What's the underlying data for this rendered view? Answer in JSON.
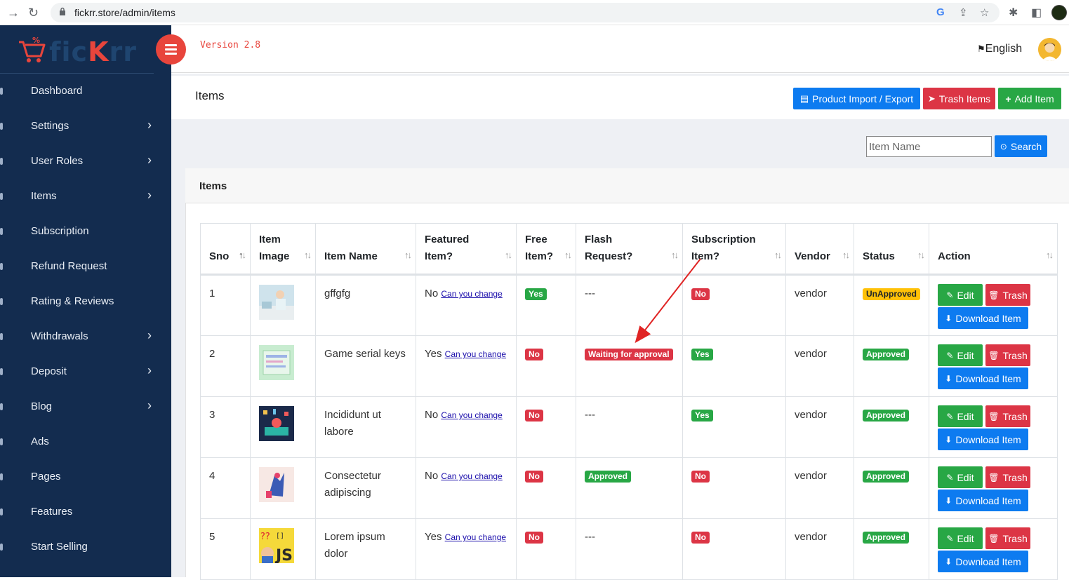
{
  "browser": {
    "url": "fickrr.store/admin/items"
  },
  "brand": {
    "logo_prefix": "fic",
    "logo_highlight": "K",
    "logo_suffix": "rr",
    "version": "Version 2.8",
    "accent_color": "#e8453c",
    "sidebar_color": "#132c4f"
  },
  "sidebar": {
    "items": [
      {
        "label": "Dashboard",
        "has_submenu": false
      },
      {
        "label": "Settings",
        "has_submenu": true
      },
      {
        "label": "User Roles",
        "has_submenu": true
      },
      {
        "label": "Items",
        "has_submenu": true
      },
      {
        "label": "Subscription",
        "has_submenu": false
      },
      {
        "label": "Refund Request",
        "has_submenu": false
      },
      {
        "label": "Rating & Reviews",
        "has_submenu": false
      },
      {
        "label": "Withdrawals",
        "has_submenu": true
      },
      {
        "label": "Deposit",
        "has_submenu": true
      },
      {
        "label": "Blog",
        "has_submenu": true
      },
      {
        "label": "Ads",
        "has_submenu": false
      },
      {
        "label": "Pages",
        "has_submenu": false
      },
      {
        "label": "Features",
        "has_submenu": false
      },
      {
        "label": "Start Selling",
        "has_submenu": false
      }
    ]
  },
  "header": {
    "language": "English"
  },
  "page": {
    "title": "Items",
    "import_export_label": "Product Import / Export",
    "trash_items_label": "Trash Items",
    "add_item_label": "Add Item",
    "search_placeholder": "Item Name",
    "search_label": "Search",
    "card_title": "Items"
  },
  "table": {
    "columns": [
      {
        "line1": "Sno",
        "line2": ""
      },
      {
        "line1": "Item",
        "line2": "Image"
      },
      {
        "line1": "Item Name",
        "line2": ""
      },
      {
        "line1": "Featured",
        "line2": "Item?"
      },
      {
        "line1": "Free",
        "line2": "Item?"
      },
      {
        "line1": "Flash",
        "line2": "Request?"
      },
      {
        "line1": "Subscription",
        "line2": "Item?"
      },
      {
        "line1": "Vendor",
        "line2": ""
      },
      {
        "line1": "Status",
        "line2": ""
      },
      {
        "line1": "Action",
        "line2": ""
      }
    ],
    "change_link": "Can you change",
    "edit_label": "Edit",
    "trash_label": "Trash",
    "download_label": "Download Item",
    "rows": [
      {
        "sno": "1",
        "name": "gffgfg",
        "featured": "No",
        "free": "Yes",
        "flash": "---",
        "subscription": "No",
        "vendor": "vendor",
        "status": "UnApproved"
      },
      {
        "sno": "2",
        "name": "Game serial keys",
        "featured": "Yes",
        "free": "No",
        "flash": "Waiting for approval",
        "subscription": "Yes",
        "vendor": "vendor",
        "status": "Approved"
      },
      {
        "sno": "3",
        "name": "Incididunt ut labore",
        "featured": "No",
        "free": "No",
        "flash": "---",
        "subscription": "Yes",
        "vendor": "vendor",
        "status": "Approved"
      },
      {
        "sno": "4",
        "name": "Consectetur adipiscing",
        "featured": "No",
        "free": "No",
        "flash": "Approved",
        "subscription": "No",
        "vendor": "vendor",
        "status": "Approved"
      },
      {
        "sno": "5",
        "name": "Lorem ipsum dolor",
        "featured": "Yes",
        "free": "No",
        "flash": "---",
        "subscription": "No",
        "vendor": "vendor",
        "status": "Approved"
      }
    ]
  }
}
